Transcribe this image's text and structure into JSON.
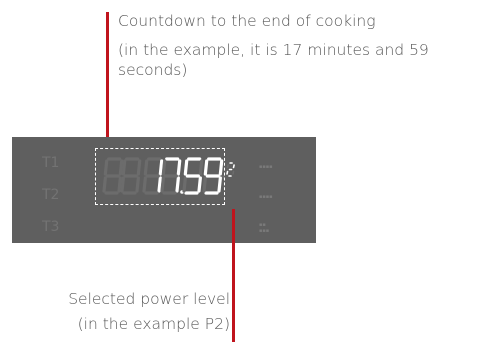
{
  "annotations": {
    "countdown_line1": "Countdown to the end of cooking",
    "countdown_line2": "(in the example, it is 17 minutes and 59 seconds)",
    "power_line1": "Selected power level",
    "power_line2": "(in the example P2)"
  },
  "display": {
    "zone_labels": [
      "T1",
      "T2",
      "T3"
    ],
    "time_minutes": "17",
    "time_seconds": "59",
    "power_level": "2",
    "colors": {
      "panel": "#5f5f5f",
      "segment_on": "#ffffff",
      "segment_off": "#6c6c6c",
      "leader_line": "#c0141d"
    }
  }
}
